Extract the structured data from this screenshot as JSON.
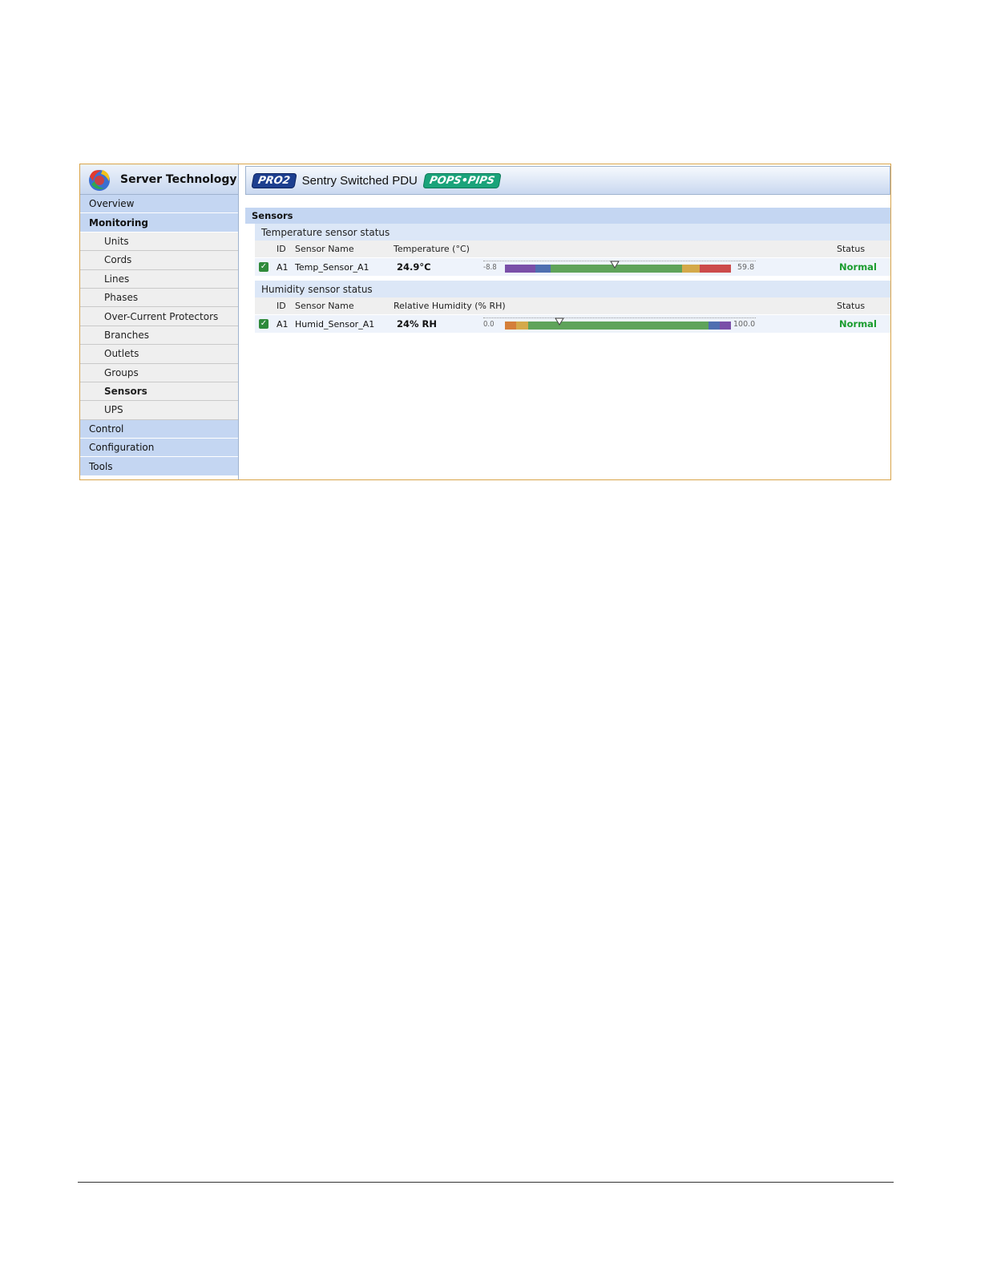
{
  "brand": {
    "name": "Server Technology"
  },
  "header": {
    "pro_badge": "PRO2",
    "title": "Sentry Switched PDU",
    "pops_badge": "POPS•PIPS"
  },
  "nav": {
    "overview": "Overview",
    "monitoring": "Monitoring",
    "sub": [
      "Units",
      "Cords",
      "Lines",
      "Phases",
      "Over-Current Protectors",
      "Branches",
      "Outlets",
      "Groups",
      "Sensors",
      "UPS"
    ],
    "control": "Control",
    "configuration": "Configuration",
    "tools": "Tools"
  },
  "section": {
    "title": "Sensors"
  },
  "temperature": {
    "group_title": "Temperature sensor status",
    "headers": {
      "id": "ID",
      "name": "Sensor Name",
      "value": "Temperature (°C)",
      "status": "Status"
    },
    "row": {
      "id": "A1",
      "name": "Temp_Sensor_A1",
      "reading": "24.9°C",
      "status": "Normal",
      "min": "-8.8",
      "max": "59.8",
      "pointer_fraction": 0.487
    }
  },
  "humidity": {
    "group_title": "Humidity sensor status",
    "headers": {
      "id": "ID",
      "name": "Sensor Name",
      "value": "Relative Humidity (% RH)",
      "status": "Status"
    },
    "row": {
      "id": "A1",
      "name": "Humid_Sensor_A1",
      "reading": "24% RH",
      "status": "Normal",
      "min": "0.0",
      "max": "100.0",
      "pointer_fraction": 0.24
    }
  },
  "colors": {
    "accent_border": "#d9a44a",
    "nav_blue": "#c4d6f2",
    "status_normal": "#1a9c2e"
  }
}
